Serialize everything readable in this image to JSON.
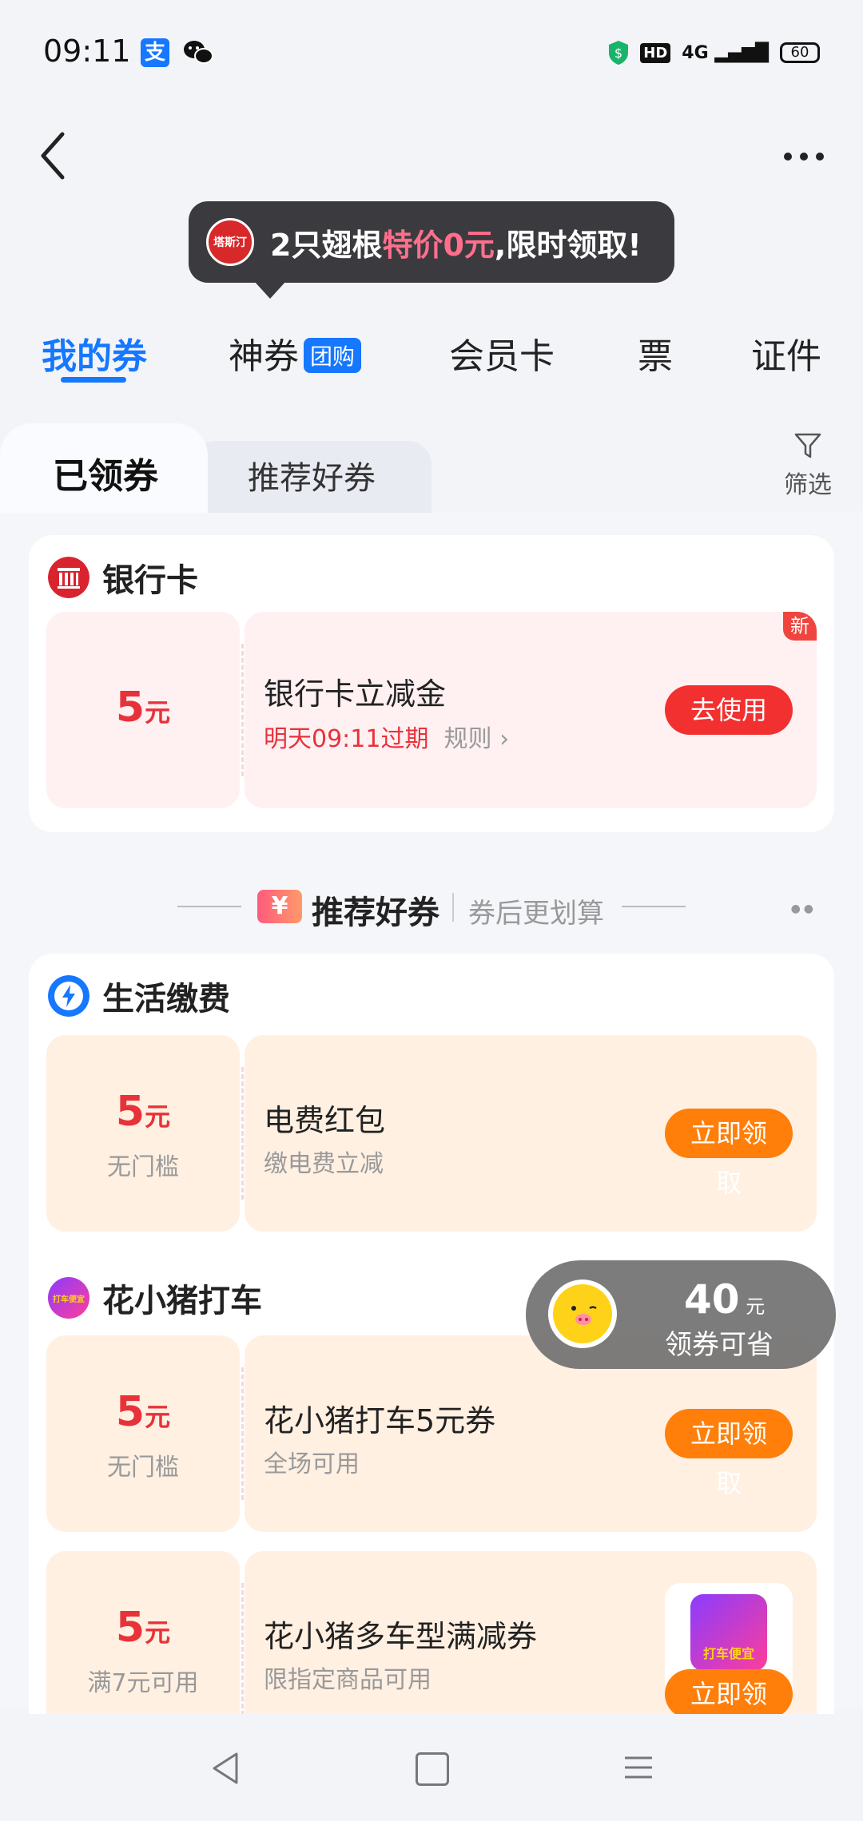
{
  "status_bar": {
    "time": "09:11",
    "alipay_glyph": "支",
    "hd": "HD",
    "network": "4G",
    "battery": "60"
  },
  "tooltip": {
    "logo_text": "塔斯汀",
    "prefix": "2只翅根",
    "highlight": "特价0元",
    "suffix": ",限时领取!"
  },
  "top_tabs": [
    {
      "label": "我的券",
      "active": true
    },
    {
      "label": "神券",
      "badge": "团购"
    },
    {
      "label": "会员卡"
    },
    {
      "label": "票"
    },
    {
      "label": "证件"
    }
  ],
  "sub_tabs": {
    "claimed": "已领券",
    "recommended": "推荐好券",
    "filter": "筛选"
  },
  "bank_card": {
    "title": "银行卡",
    "new_badge": "新",
    "coupon": {
      "amount": "5",
      "unit": "元",
      "title": "银行卡立减金",
      "expiry": "明天09:11过期",
      "rules": "规则",
      "button": "去使用"
    }
  },
  "section": {
    "icon": "¥",
    "title": "推荐好券",
    "subtitle": "券后更划算"
  },
  "life_pay": {
    "title": "生活缴费",
    "coupon": {
      "amount": "5",
      "unit": "元",
      "condition": "无门槛",
      "title": "电费红包",
      "subtitle": "缴电费立减",
      "button": "立即领取"
    }
  },
  "huaxiaozhu": {
    "title": "花小猪打车",
    "icon_text": "打车便宜",
    "coupons": [
      {
        "amount": "5",
        "unit": "元",
        "condition": "无门槛",
        "title": "花小猪打车5元券",
        "subtitle": "全场可用",
        "button": "立即领取"
      },
      {
        "amount": "5",
        "unit": "元",
        "condition": "满7元可用",
        "title": "花小猪多车型满减券",
        "subtitle": "限指定商品可用",
        "button": "立即领取",
        "thumb_text": "打车便宜"
      }
    ]
  },
  "floating": {
    "amount": "40",
    "unit": "元",
    "label": "领券可省"
  },
  "colors": {
    "accent": "#1677ff",
    "red": "#e8323a",
    "orange_btn": "#ff7f0a",
    "red_btn": "#f23030"
  }
}
